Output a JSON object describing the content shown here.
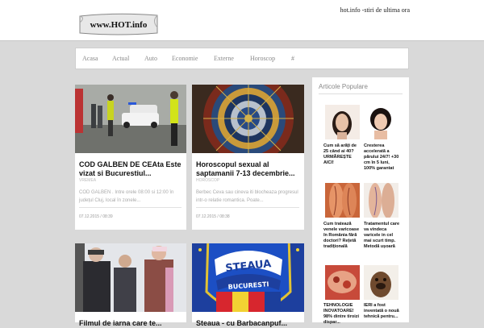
{
  "header": {
    "logo_text": "www.HOT.info",
    "tagline": "hot.info -stiri de ultima ora"
  },
  "nav": [
    {
      "label": "Acasa"
    },
    {
      "label": "Actual"
    },
    {
      "label": "Auto"
    },
    {
      "label": "Economie"
    },
    {
      "label": "Externe"
    },
    {
      "label": "Horoscop"
    },
    {
      "label": "#"
    }
  ],
  "articles": [
    {
      "title": "COD GALBEN DE CEAta Este vizat si Bucurestiul...",
      "category": "VREMEA",
      "excerpt": "COD GALBEN .  Intre orele 08:00 si 12:00 în județul Cluj, local în zonele...",
      "date": "07.12.2015 / 08:39"
    },
    {
      "title": "Horoscopul sexual al saptamanii 7-13 decembrie...",
      "category": "HOROSCOP",
      "excerpt": "Berbec Ceva sau cineva iti blocheaza progresul intr-o relatie romantica. Poate...",
      "date": "07.12.2015 / 08:38"
    },
    {
      "title": "Filmul de iarna care te..."
    },
    {
      "title": "Steaua - cu Barbacanpuf..."
    }
  ],
  "sidebar": {
    "title": "Articole Populare",
    "items": [
      {
        "text": "Cum să arăți de 25 când ai 40? URMĂREȘTE AICI!"
      },
      {
        "text": "Cresterea accelerată a părului 24/7! +30 cm în 5 luni, 100% garantat"
      },
      {
        "text": "Cum tratează venele varicoase în România fără doctori? Rețetă tradițională"
      },
      {
        "text": "Tratamentul care va vindeca varicele in cel mai scurt timp. Metodă ușoară"
      },
      {
        "text": "TEHNOLOGIE INOVATOARE! 98% dintre tiroizi dispar..."
      },
      {
        "text": "IERI a fost inventată o nouă tehnică pentru..."
      }
    ]
  }
}
